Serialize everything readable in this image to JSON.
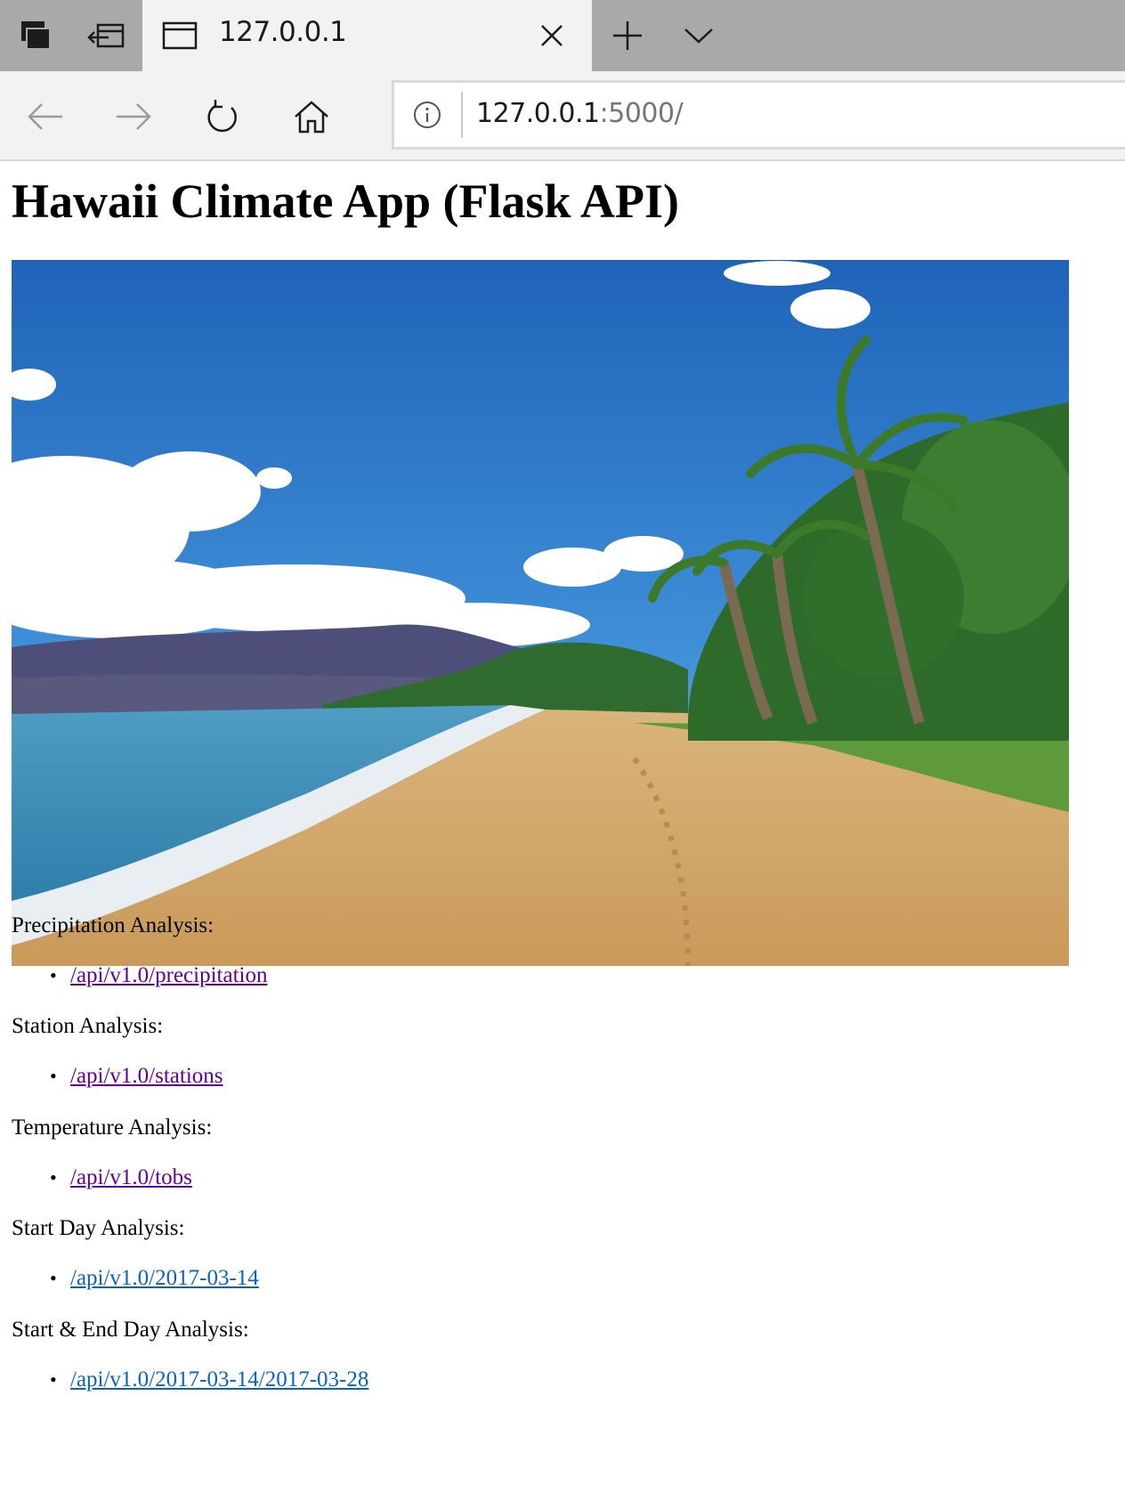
{
  "browser": {
    "tab_title": "127.0.0.1",
    "address_host": "127.0.0.1",
    "address_path": ":5000/"
  },
  "icons": {
    "tab_actions": "tab-actions-icon",
    "set_tabs_aside": "set-tabs-aside-icon",
    "tab_page": "page-icon",
    "close": "close-icon",
    "new_tab": "plus-icon",
    "tab_menu": "chevron-down-icon",
    "back": "back-arrow-icon",
    "forward": "forward-arrow-icon",
    "refresh": "refresh-icon",
    "home": "home-icon",
    "site_info": "info-icon"
  },
  "page": {
    "title": "Hawaii Climate App (Flask API)",
    "sections": [
      {
        "label": "Precipitation Analysis:",
        "link": "/api/v1.0/precipitation",
        "visited": true
      },
      {
        "label": "Station Analysis:",
        "link": "/api/v1.0/stations",
        "visited": true
      },
      {
        "label": "Temperature Analysis:",
        "link": "/api/v1.0/tobs",
        "visited": true
      },
      {
        "label": "Start Day Analysis:",
        "link": "/api/v1.0/2017-03-14",
        "visited": false
      },
      {
        "label": "Start & End Day Analysis:",
        "link": "/api/v1.0/2017-03-14/2017-03-28",
        "visited": false
      }
    ]
  },
  "colors": {
    "visited_link": "#660099",
    "link": "#0b61c5",
    "tabbar": "#a9a9a9",
    "toolbar": "#f2f2f2"
  }
}
